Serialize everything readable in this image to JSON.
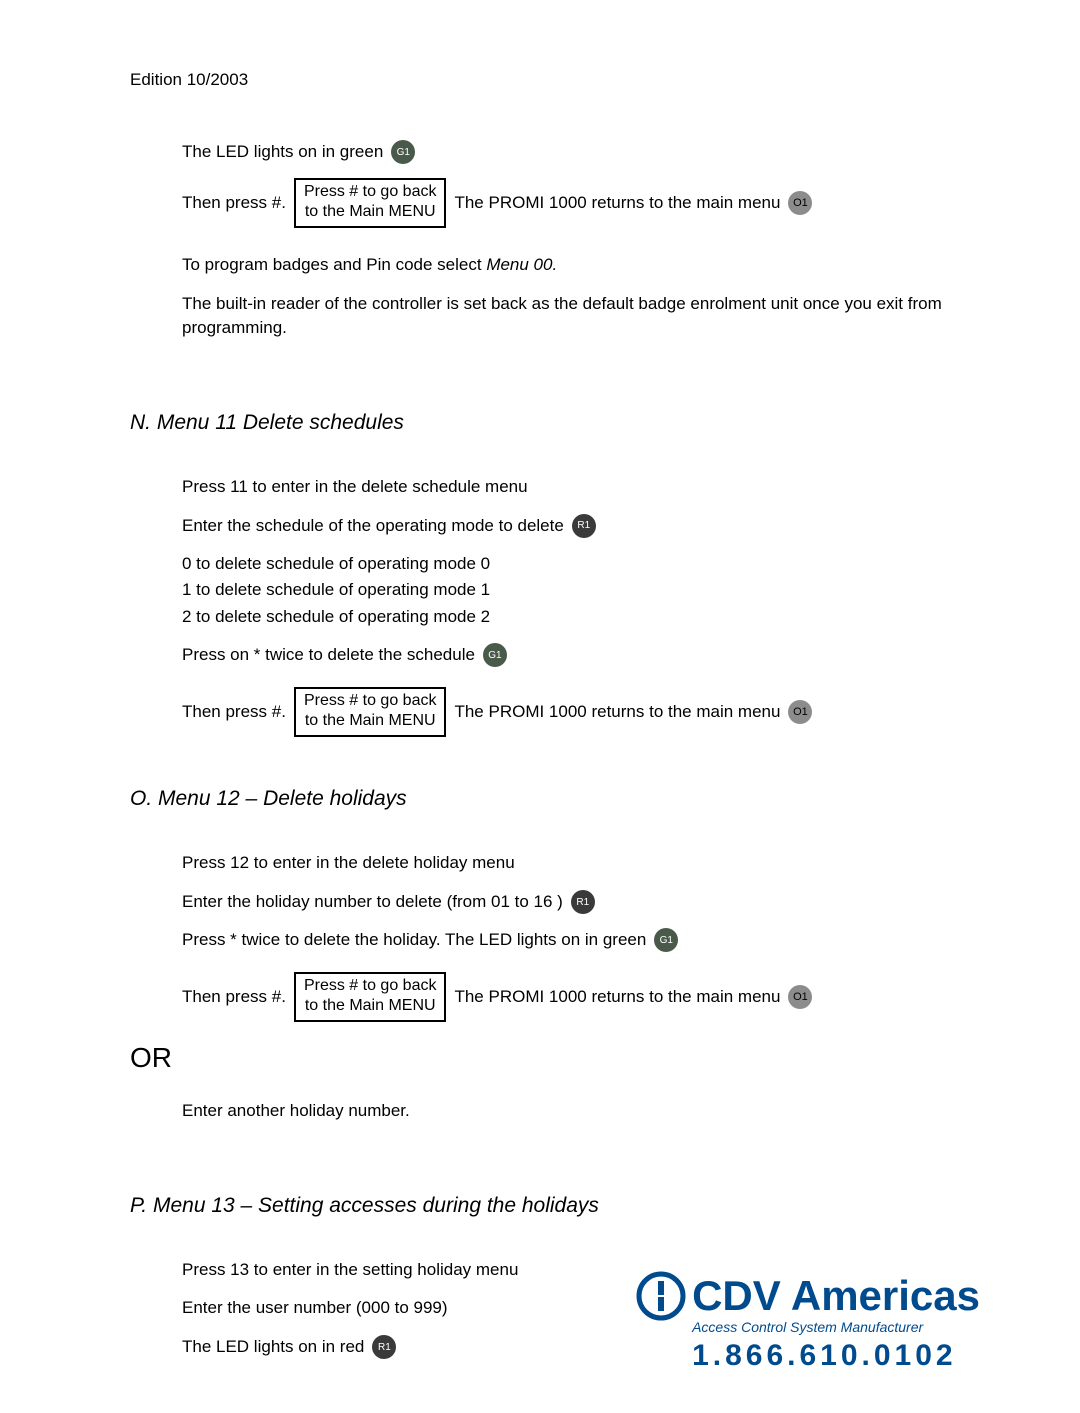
{
  "header": {
    "edition": "Edition 10/2003"
  },
  "intro": {
    "led_green_text": "The LED lights on in green",
    "then_press": "Then press #.",
    "box_line1": "Press # to go back",
    "box_line2": "to the Main MENU",
    "returns_main": "The PROMI 1000 returns to the main menu",
    "program_badges_prefix": "To program badges and Pin code select ",
    "program_badges_menu": "Menu 00.",
    "builtin_reader": "The built-in reader of the controller is set back as the default badge enrolment unit once you exit from programming."
  },
  "leds": {
    "g1": "G1",
    "o1": "O1",
    "r1": "R1"
  },
  "sectionN": {
    "title": "N.  Menu 11 Delete schedules",
    "p1": "Press 11 to enter in the delete schedule menu",
    "p2": "Enter the schedule of the operating mode to delete",
    "opt0": "0 to delete schedule of operating mode 0",
    "opt1": "1 to delete schedule of operating mode 1",
    "opt2": "2 to delete schedule of operating mode 2",
    "press_star": "Press on * twice to delete the schedule",
    "then_press": "Then press #.",
    "returns_main": "The PROMI 1000 returns to the main menu"
  },
  "sectionO": {
    "title": "O.  Menu 12 – Delete holidays",
    "p1": "Press 12 to enter in the delete holiday menu",
    "p2": "Enter the holiday number to delete (from 01 to 16 )",
    "p3": "Press * twice to delete the holiday. The LED lights on in green",
    "then_press": "Then press #.",
    "returns_main": "The PROMI 1000 returns to the main menu",
    "or": "OR",
    "or_alt": "Enter another holiday number."
  },
  "sectionP": {
    "title": "P.  Menu 13 – Setting accesses during the holidays",
    "p1": "Press 13 to enter in the setting holiday menu",
    "p2": "Enter the user number (000 to 999)",
    "p3": "The LED lights on in red"
  },
  "footer": {
    "brand": "CDV Americas",
    "tagline": "Access Control System Manufacturer",
    "phone": "1.866.610.0102"
  }
}
